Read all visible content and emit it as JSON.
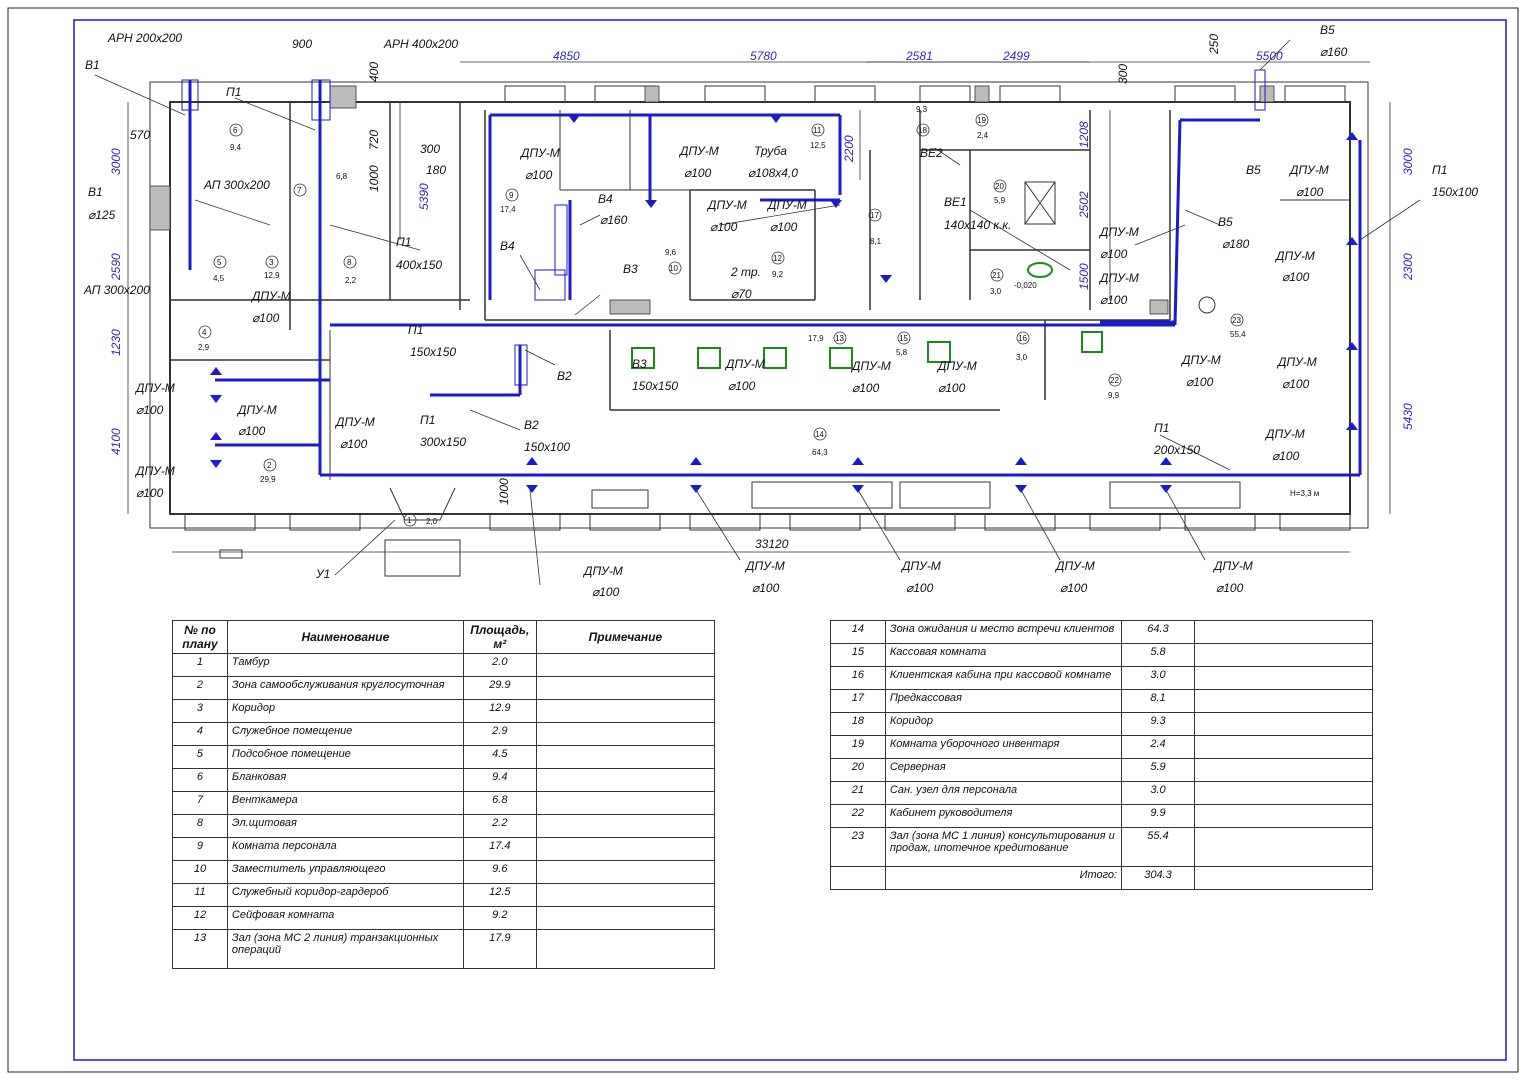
{
  "plan": {
    "duct_color": "#1b1bcc",
    "dim_color": "#2b2bb8",
    "labels": {
      "arn_200": "АРН 200х200",
      "arn_400": "АРН 400х200",
      "v1_top": "В1",
      "v1_mid": "В1",
      "v1_dia": "⌀125",
      "p1_top": "П1",
      "ap_300_a": "АП 300х200",
      "ap_300_b": "АП 300х200",
      "p1_400": "П1",
      "p1_400_size": "400х150",
      "dpu_a": "ДПУ-М",
      "dpu_a_d": "⌀100",
      "dpu_b": "ДПУ-М",
      "dpu_b_d": "⌀100",
      "dpu_c": "ДПУ-М",
      "dpu_c_d": "⌀100",
      "dpu_d": "ДПУ-М",
      "dpu_d_d": "⌀100",
      "dpu_e": "ДПУ-М",
      "dpu_e_d": "⌀100",
      "p1_150": "П1",
      "p1_150_size": "150х150",
      "p1_300": "П1",
      "p1_300_size": "300х150",
      "v2_a": "В2",
      "v2_b": "В2",
      "v2_size": "150х100",
      "dpu_f": "ДПУ-М",
      "dpu_f_d": "⌀100",
      "v4_a": "В4",
      "v4_b": "В4",
      "v4_dia": "⌀160",
      "v3_a": "В3",
      "v3_b": "В3",
      "v3_size": "150х150",
      "dpu_g": "ДПУ-М",
      "dpu_g_d": "⌀100",
      "truba": "Труба",
      "truba_size": "⌀108х4,0",
      "dpu_h": "ДПУ-М",
      "dpu_h_d": "⌀100",
      "dpu_i": "ДПУ-М",
      "dpu_i_d": "⌀100",
      "two_tr": "2 тр.",
      "two_tr_d": "⌀70",
      "dpu_j": "ДПУ-М",
      "dpu_j_d": "⌀100",
      "dpu_k": "ДПУ-М",
      "dpu_k_d": "⌀100",
      "dpu_l": "ДПУ-М",
      "dpu_l_d": "⌀100",
      "be2": "ВЕ2",
      "be1": "ВЕ1",
      "be1_size": "140х140 к.к.",
      "level": "-0,020",
      "dpu_m": "ДПУ-М",
      "dpu_m_d": "⌀100",
      "dpu_n": "ДПУ-М",
      "dpu_n_d": "⌀100",
      "v5_top": "В5",
      "v5_top_d": "⌀160",
      "v5_a": "В5",
      "v5_b": "В5",
      "v5_b_d": "⌀180",
      "dpu_o": "ДПУ-М",
      "dpu_o_d": "⌀100",
      "p1_right": "П1",
      "p1_right_size": "150х100",
      "dpu_p": "ДПУ-М",
      "dpu_p_d": "⌀100",
      "dpu_q": "ДПУ-М",
      "dpu_q_d": "⌀100",
      "dpu_r": "ДПУ-М",
      "dpu_r_d": "⌀100",
      "dpu_s": "ДПУ-М",
      "dpu_s_d": "⌀100",
      "p1_200": "П1",
      "p1_200_size": "200х150",
      "height": "Н=3,3 м",
      "y1": "У1",
      "dpu_b1": "ДПУ-М",
      "dpu_b1_d": "⌀100",
      "dpu_b2": "ДПУ-М",
      "dpu_b2_d": "⌀100",
      "dpu_b3": "ДПУ-М",
      "dpu_b3_d": "⌀100",
      "dpu_b4": "ДПУ-М",
      "dpu_b4_d": "⌀100",
      "dpu_b5": "ДПУ-М",
      "dpu_b5_d": "⌀100"
    },
    "dims": {
      "d900": "900",
      "d400": "400",
      "d720": "720",
      "d1000a": "1000",
      "d300": "300",
      "d180": "180",
      "d5390": "5390",
      "d570": "570",
      "d3000a": "3000",
      "d2590": "2590",
      "d1230": "1230",
      "d4100": "4100",
      "d4850": "4850",
      "d5780": "5780",
      "d2581": "2581",
      "d2499": "2499",
      "d2200": "2200",
      "d1208": "1208",
      "d2502": "2502",
      "d1500": "1500",
      "d250": "250",
      "d5500": "5500",
      "d300r": "300",
      "d3000b": "3000",
      "d2300": "2300",
      "d5430": "5430",
      "d1000b": "1000",
      "d33120": "33120"
    },
    "rooms": [
      {
        "n": "6",
        "a": "9,4"
      },
      {
        "n": "7",
        "a": "6,8"
      },
      {
        "n": "5",
        "a": "4,5"
      },
      {
        "n": "3",
        "a": "12,9"
      },
      {
        "n": "8",
        "a": "2,2"
      },
      {
        "n": "4",
        "a": "2,9"
      },
      {
        "n": "2",
        "a": "29,9"
      },
      {
        "n": "1",
        "a": "2,0"
      },
      {
        "n": "9",
        "a": "17,4"
      },
      {
        "n": "10",
        "a": "9,6"
      },
      {
        "n": "11",
        "a": "12,5"
      },
      {
        "n": "12",
        "a": "9,2"
      },
      {
        "n": "17",
        "a": "8,1"
      },
      {
        "n": "13",
        "a": "17,9"
      },
      {
        "n": "15",
        "a": "5,8"
      },
      {
        "n": "16",
        "a": "3,0"
      },
      {
        "n": "14",
        "a": "64,3"
      },
      {
        "n": "18",
        "a": "9,3"
      },
      {
        "n": "19",
        "a": "2,4"
      },
      {
        "n": "20",
        "a": "5,9"
      },
      {
        "n": "21",
        "a": "3,0"
      },
      {
        "n": "22",
        "a": "9,9"
      },
      {
        "n": "23",
        "a": "55,4"
      }
    ]
  },
  "table": {
    "headers": {
      "no": "№ по плану",
      "name": "Наименование",
      "area": "Площадь, м²",
      "note": "Примечание"
    },
    "rows_left": [
      {
        "no": "1",
        "name": "Тамбур",
        "area": "2.0"
      },
      {
        "no": "2",
        "name": "Зона самообслуживания круглосуточная",
        "area": "29.9"
      },
      {
        "no": "3",
        "name": "Коридор",
        "area": "12.9"
      },
      {
        "no": "4",
        "name": "Служебное помещение",
        "area": "2.9"
      },
      {
        "no": "5",
        "name": "Подсобное помещение",
        "area": "4.5"
      },
      {
        "no": "6",
        "name": "Бланковая",
        "area": "9.4"
      },
      {
        "no": "7",
        "name": "Венткамера",
        "area": "6.8"
      },
      {
        "no": "8",
        "name": "Эл.щитовая",
        "area": "2.2"
      },
      {
        "no": "9",
        "name": "Комната персонала",
        "area": "17.4"
      },
      {
        "no": "10",
        "name": "Заместитель управляющего",
        "area": "9.6"
      },
      {
        "no": "11",
        "name": "Служебный коридор-гардероб",
        "area": "12.5"
      },
      {
        "no": "12",
        "name": "Сейфовая комната",
        "area": "9.2"
      },
      {
        "no": "13",
        "name": "Зал (зона МС 2 линия) транзакционных операций",
        "area": "17.9"
      }
    ],
    "rows_right": [
      {
        "no": "14",
        "name": "Зона ожидания и место встречи клиентов",
        "area": "64.3"
      },
      {
        "no": "15",
        "name": "Кассовая комната",
        "area": "5.8"
      },
      {
        "no": "16",
        "name": "Клиентская кабина при кассовой комнате",
        "area": "3.0"
      },
      {
        "no": "17",
        "name": "Предкассовая",
        "area": "8.1"
      },
      {
        "no": "18",
        "name": "Коридор",
        "area": "9.3"
      },
      {
        "no": "19",
        "name": "Комната уборочного инвентаря",
        "area": "2.4"
      },
      {
        "no": "20",
        "name": "Серверная",
        "area": "5.9"
      },
      {
        "no": "21",
        "name": "Сан. узел для персонала",
        "area": "3.0"
      },
      {
        "no": "22",
        "name": "Кабинет руководителя",
        "area": "9.9"
      },
      {
        "no": "23",
        "name": "Зал (зона МС 1 линия) консультирования и продаж, ипотечное кредитование",
        "area": "55.4"
      }
    ],
    "total_label": "Итого:",
    "total_value": "304.3"
  }
}
